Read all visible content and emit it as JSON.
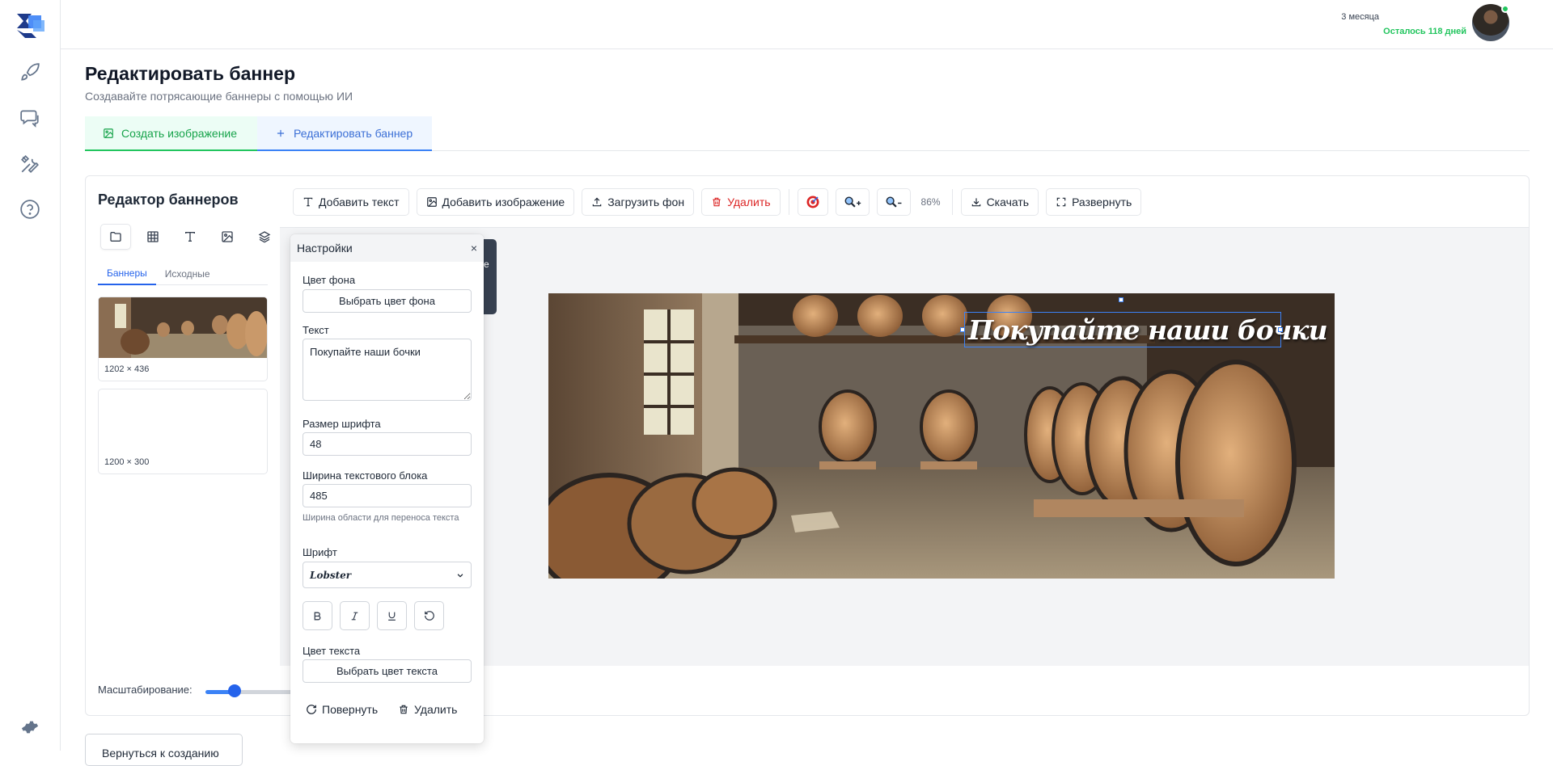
{
  "header": {
    "plan": "3 месяца",
    "remaining": "Осталось 118 дней"
  },
  "page": {
    "title": "Редактировать баннер",
    "subtitle": "Создавайте потрясающие баннеры с помощью ИИ"
  },
  "tabs": [
    {
      "label": "Создать изображение",
      "icon": "image-icon"
    },
    {
      "label": "Редактировать баннер",
      "icon": "plus-icon"
    }
  ],
  "left_panel": {
    "title": "Редактор баннеров",
    "tools": [
      "folder-icon",
      "grid-icon",
      "text-icon",
      "image-icon",
      "layers-icon"
    ],
    "subtabs": [
      "Баннеры",
      "Исходные"
    ],
    "banners": [
      {
        "size": "1202 × 436"
      },
      {
        "size": "1200 × 300"
      }
    ],
    "zoom_label": "Масштабирование:",
    "zoom_level": 0.3
  },
  "toolbar": {
    "add_text": "Добавить текст",
    "add_image": "Добавить изображение",
    "upload_bg": "Загрузить фон",
    "delete": "Удалить",
    "zoom_pct": "86%",
    "download": "Скачать",
    "expand": "Развернуть"
  },
  "banner": {
    "text": "Покупайте наши бочки"
  },
  "settings": {
    "title": "Настройки",
    "close": "×",
    "bg_color_label": "Цвет фона",
    "bg_color_btn": "Выбрать цвет фона",
    "text_label": "Текст",
    "text_value": "Покупайте наши бочки",
    "font_size_label": "Размер шрифта",
    "font_size_value": "48",
    "width_label": "Ширина текстового блока",
    "width_value": "485",
    "width_help": "Ширина области для переноса текста",
    "font_label": "Шрифт",
    "font_value": "Lobster",
    "text_color_label": "Цвет текста",
    "text_color_btn": "Выбрать цвет текста",
    "rotate": "Повернуть",
    "delete": "Удалить"
  },
  "tooltip_fragment": "е",
  "back_button": "Вернуться к созданию",
  "colors": {
    "accent": "#2563eb",
    "success": "#22c55e",
    "danger": "#dc2626"
  }
}
